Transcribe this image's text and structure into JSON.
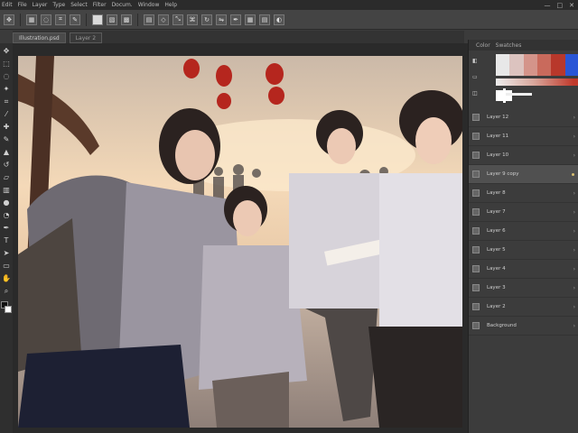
{
  "app": {
    "menu": [
      "Edit",
      "File",
      "Layer",
      "Type",
      "Select",
      "Filter",
      "Docum.",
      "Window",
      "Help"
    ],
    "window_controls": [
      "—",
      "□",
      "✕"
    ]
  },
  "tabs": [
    {
      "label": "Illustration.psd"
    },
    {
      "label": "Layer 2"
    }
  ],
  "options": {
    "icons": [
      "move",
      "marquee",
      "lasso",
      "crop",
      "eyedropper",
      "brush",
      "eraser",
      "gradient"
    ]
  },
  "tools": [
    "move",
    "marquee",
    "lasso",
    "magic-wand",
    "crop",
    "eyedropper",
    "heal",
    "brush",
    "stamp",
    "history",
    "eraser",
    "gradient",
    "blur",
    "dodge",
    "pen",
    "type",
    "path",
    "shape",
    "hand",
    "zoom",
    "extra"
  ],
  "colors": {
    "foreground": "#111111",
    "background": "#ffffff",
    "gradient": [
      "#e8e8e8",
      "#dcc3bf",
      "#d4948a",
      "#c96a5c",
      "#b8382b",
      "#2a56d6"
    ]
  },
  "panel": {
    "tabs": [
      "Color",
      "Swatches"
    ],
    "layers": [
      {
        "name": "Layer 12",
        "selected": false
      },
      {
        "name": "Layer 11",
        "selected": false
      },
      {
        "name": "Layer 10",
        "selected": false
      },
      {
        "name": "Layer 9 copy",
        "selected": true
      },
      {
        "name": "Layer 8",
        "selected": false
      },
      {
        "name": "Layer 7",
        "selected": false
      },
      {
        "name": "Layer 6",
        "selected": false
      },
      {
        "name": "Layer 5",
        "selected": false
      },
      {
        "name": "Layer 4",
        "selected": false
      },
      {
        "name": "Layer 3",
        "selected": false
      },
      {
        "name": "Layer 2",
        "selected": false
      },
      {
        "name": "Background",
        "selected": false
      }
    ]
  }
}
